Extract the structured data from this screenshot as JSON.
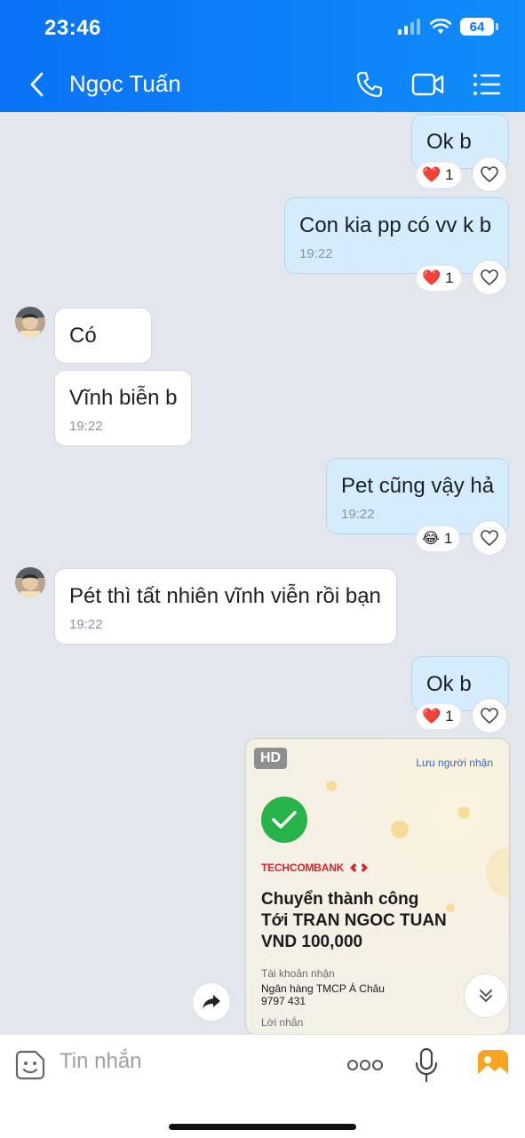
{
  "status_bar": {
    "time": "23:46",
    "battery": "64"
  },
  "header": {
    "contact_name": "Ngọc Tuấn"
  },
  "messages": [
    {
      "text": "Ok b",
      "reaction": {
        "emoji": "❤️",
        "count": "1"
      }
    },
    {
      "text": "Con kia pp có vv k b",
      "time": "19:22",
      "reaction": {
        "emoji": "❤️",
        "count": "1"
      }
    },
    {
      "text": "Có"
    },
    {
      "text": "Vĩnh biễn b",
      "time": "19:22"
    },
    {
      "text": "Pet cũng vậy hả",
      "time": "19:22",
      "reaction": {
        "emoji": "😂",
        "count": "1"
      }
    },
    {
      "text": "Pét thì tất nhiên vĩnh viễn rồi bạn",
      "time": "19:22"
    },
    {
      "text": "Ok b",
      "reaction": {
        "emoji": "❤️",
        "count": "1"
      }
    }
  ],
  "transfer_image": {
    "hd_badge": "HD",
    "save_recipient": "Lưu người nhận",
    "bank_name": "TECHCOMBANK",
    "title": "Chuyển thành công",
    "recipient_line": "Tới TRAN NGOC TUAN",
    "amount": "VND 100,000",
    "account_label": "Tài khoản nhận",
    "account_bank": "Ngân hàng TMCP Á Châu",
    "account_number": "9797 431",
    "message_label": "Lời nhắn"
  },
  "composer": {
    "placeholder": "Tin nhắn"
  },
  "colors": {
    "header": "#0a72f6",
    "outgoing_bubble": "#d4ecfc",
    "incoming_bubble": "#ffffff",
    "background": "#e2e7ee",
    "success": "#27b24a",
    "techcombank_red": "#d4262b"
  }
}
